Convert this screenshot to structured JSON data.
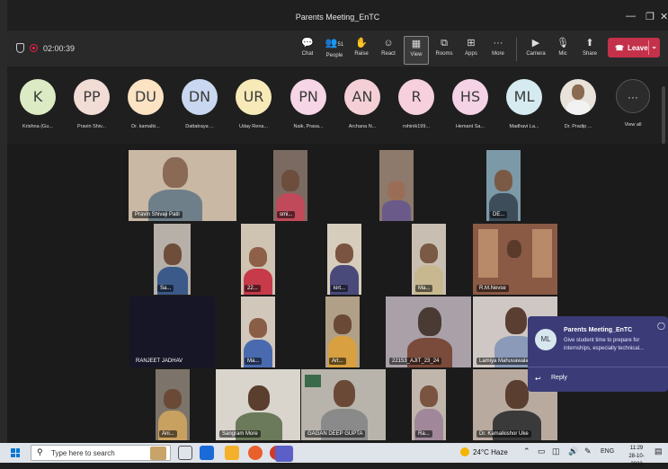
{
  "window": {
    "title": "Parents Meeting_EnTC",
    "minimize": "—",
    "restore": "❐",
    "close": "✕"
  },
  "meeting": {
    "timer": "02:00:39"
  },
  "toolbar": {
    "buttons": [
      {
        "label": "Chat",
        "icon": "chat-icon",
        "glyph": "💬"
      },
      {
        "label": "People",
        "icon": "people-icon",
        "glyph": "👥",
        "count": "51"
      },
      {
        "label": "Raise",
        "icon": "raise-hand-icon",
        "glyph": "✋"
      },
      {
        "label": "React",
        "icon": "react-icon",
        "glyph": "☺"
      },
      {
        "label": "View",
        "icon": "view-grid-icon",
        "glyph": "▦"
      },
      {
        "label": "Rooms",
        "icon": "rooms-icon",
        "glyph": "⧉"
      },
      {
        "label": "Apps",
        "icon": "apps-icon",
        "glyph": "⊞"
      },
      {
        "label": "More",
        "icon": "more-icon",
        "glyph": "···"
      },
      {
        "label": "Camera",
        "icon": "camera-off-icon",
        "glyph": "▶"
      },
      {
        "label": "Mic",
        "icon": "mic-icon",
        "glyph": "🎙"
      },
      {
        "label": "Share",
        "icon": "share-icon",
        "glyph": "⬆"
      }
    ],
    "leave_label": "Leave",
    "leave_color": "#c4314b"
  },
  "participants_strip": {
    "items": [
      {
        "initials": "K",
        "name": "Krishna (Gu...",
        "color": "#dcebc4"
      },
      {
        "initials": "PP",
        "name": "Pravin Shiv...",
        "color": "#f1ddd6"
      },
      {
        "initials": "DU",
        "name": "Dr. kamalki...",
        "color": "#fbe3c4"
      },
      {
        "initials": "DN",
        "name": "Dattatraya ...",
        "color": "#c9d8f0"
      },
      {
        "initials": "UR",
        "name": "Uday Rena...",
        "color": "#f7eab8"
      },
      {
        "initials": "PN",
        "name": "Naik, Prasa...",
        "color": "#f6d6e6"
      },
      {
        "initials": "AN",
        "name": "Archana N...",
        "color": "#f4d0d6"
      },
      {
        "initials": "R",
        "name": "rohinik199...",
        "color": "#f6d0dc"
      },
      {
        "initials": "HS",
        "name": "Hemant Sa...",
        "color": "#f5d3e6"
      },
      {
        "initials": "ML",
        "name": "Madhavi La...",
        "color": "#d5ebf0"
      },
      {
        "initials": "",
        "name": "Dr. Pradip ...",
        "color": "#8a6a50"
      }
    ],
    "view_all_label": "View all",
    "view_all_glyph": "···"
  },
  "video_tiles": [
    {
      "name": "Pravin Shivaji Patil",
      "bg": "#c9b8a4"
    },
    {
      "name": "smi...",
      "bg": "#7a6a62"
    },
    {
      "name": "",
      "bg": "#8d7a6c"
    },
    {
      "name": "DE...",
      "bg": "#7c99a8"
    },
    {
      "name": "Sa...",
      "bg": "#b7b0a8"
    },
    {
      "name": "22...",
      "bg": "#cfc3b2"
    },
    {
      "name": "kirt...",
      "bg": "#d6cdbc"
    },
    {
      "name": "Ma...",
      "bg": "#c8bfb2"
    },
    {
      "name": "R.M.Nevse",
      "bg": "#8a5a44"
    },
    {
      "name": "RANJEET JADHAV",
      "bg": "#161627"
    },
    {
      "name": "Ma...",
      "bg": "#d1c8bb"
    },
    {
      "name": "Art...",
      "bg": "#b0a088"
    },
    {
      "name": "22153_AJIT_23_24",
      "bg": "#a9a0a8"
    },
    {
      "name": "Lamiya Mahuvawala",
      "bg": "#cfc7c4"
    },
    {
      "name": "Ani...",
      "bg": "#7c746a"
    },
    {
      "name": "Sangram More",
      "bg": "#d9d4cc"
    },
    {
      "name": "GAGAN DEEP GUPTA",
      "bg": "#b8b4ac"
    },
    {
      "name": "Ra...",
      "bg": "#c0b6ac"
    },
    {
      "name": "Dr. Kamalkishor Uke",
      "bg": "#b9aaa0"
    }
  ],
  "notification": {
    "avatar": "ML",
    "title": "Parents Meeting_EnTC",
    "message": "Give student time to prepare for internships, especially technical...",
    "reply_label": "Reply"
  },
  "taskbar": {
    "search_placeholder": "Type here to search",
    "weather": "24°C  Haze",
    "lang": "ENG",
    "time": "11:29",
    "date": "28-10-2023"
  }
}
